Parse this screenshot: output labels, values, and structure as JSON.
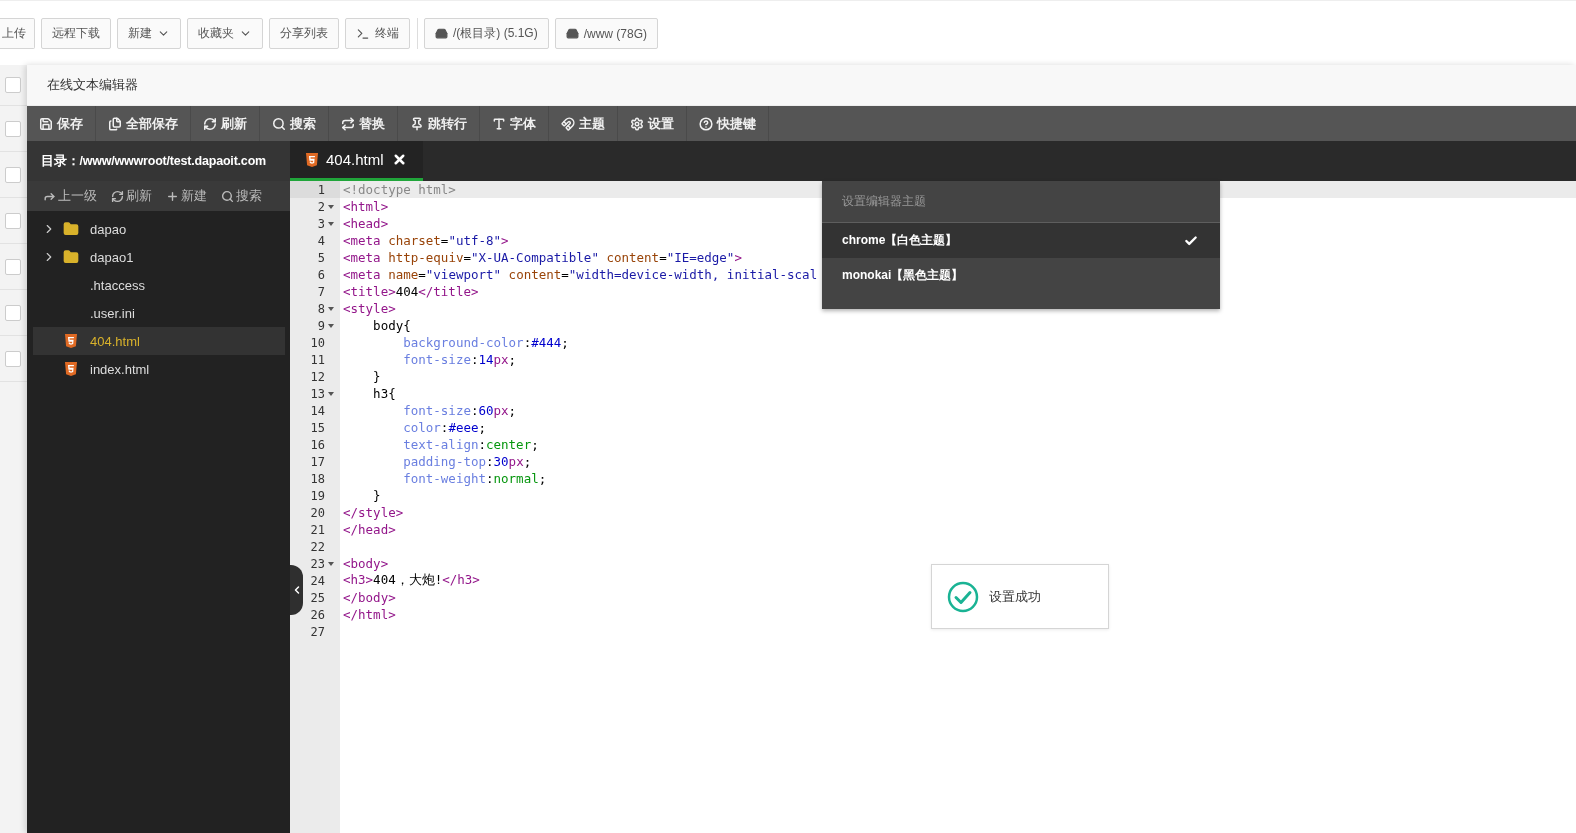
{
  "top_toolbar": [
    {
      "label": "上传",
      "kind": "plain"
    },
    {
      "label": "远程下载",
      "kind": "plain"
    },
    {
      "label": "新建",
      "kind": "dropdown"
    },
    {
      "label": "收藏夹",
      "kind": "dropdown"
    },
    {
      "label": "分享列表",
      "kind": "plain"
    },
    {
      "label": "终端",
      "kind": "terminal"
    },
    {
      "label": "/(根目录) (5.1G)",
      "kind": "disk"
    },
    {
      "label": "/www (78G)",
      "kind": "disk"
    }
  ],
  "background_rows": [
    {
      "checked": false
    },
    {
      "checked": false
    },
    {
      "checked": false
    },
    {
      "checked": false
    },
    {
      "checked": false
    },
    {
      "checked": false
    },
    {
      "checked": false
    }
  ],
  "window": {
    "title": "在线文本编辑器"
  },
  "editor_toolbar": [
    "保存",
    "全部保存",
    "刷新",
    "搜索",
    "替换",
    "跳转行",
    "字体",
    "主题",
    "设置",
    "快捷键"
  ],
  "sidebar": {
    "directory": "目录：/www/wwwroot/test.dapaoit.com",
    "actions": [
      "上一级",
      "刷新",
      "新建",
      "搜索"
    ],
    "items": [
      {
        "name": "dapao",
        "kind": "folder",
        "selected": false
      },
      {
        "name": "dapao1",
        "kind": "folder",
        "selected": false
      },
      {
        "name": ".htaccess",
        "kind": "file",
        "selected": false
      },
      {
        "name": ".user.ini",
        "kind": "file",
        "selected": false
      },
      {
        "name": "404.html",
        "kind": "html",
        "selected": true
      },
      {
        "name": "index.html",
        "kind": "html",
        "selected": false
      }
    ]
  },
  "tabs": [
    {
      "label": "404.html",
      "selected": true
    }
  ],
  "code_lines": [
    {
      "number": "1",
      "active": true,
      "foldable": false,
      "text": "<!doctype html>"
    },
    {
      "number": "2",
      "active": false,
      "foldable": true,
      "text": "<html>"
    },
    {
      "number": "3",
      "active": false,
      "foldable": true,
      "text": "<head>"
    },
    {
      "number": "4",
      "active": false,
      "foldable": false,
      "text": "<meta charset=\"utf-8\">"
    },
    {
      "number": "5",
      "active": false,
      "foldable": false,
      "text": "<meta http-equiv=\"X-UA-Compatible\" content=\"IE=edge\">"
    },
    {
      "number": "6",
      "active": false,
      "foldable": false,
      "text": "<meta name=\"viewport\" content=\"width=device-width, initial-scal"
    },
    {
      "number": "7",
      "active": false,
      "foldable": false,
      "text": "<title>404</title>"
    },
    {
      "number": "8",
      "active": false,
      "foldable": true,
      "text": "<style>"
    },
    {
      "number": "9",
      "active": false,
      "foldable": true,
      "text": "    body{"
    },
    {
      "number": "10",
      "active": false,
      "foldable": false,
      "text": "        background-color:#444;"
    },
    {
      "number": "11",
      "active": false,
      "foldable": false,
      "text": "        font-size:14px;"
    },
    {
      "number": "12",
      "active": false,
      "foldable": false,
      "text": "    }"
    },
    {
      "number": "13",
      "active": false,
      "foldable": true,
      "text": "    h3{"
    },
    {
      "number": "14",
      "active": false,
      "foldable": false,
      "text": "        font-size:60px;"
    },
    {
      "number": "15",
      "active": false,
      "foldable": false,
      "text": "        color:#eee;"
    },
    {
      "number": "16",
      "active": false,
      "foldable": false,
      "text": "        text-align:center;"
    },
    {
      "number": "17",
      "active": false,
      "foldable": false,
      "text": "        padding-top:30px;"
    },
    {
      "number": "18",
      "active": false,
      "foldable": false,
      "text": "        font-weight:normal;"
    },
    {
      "number": "19",
      "active": false,
      "foldable": false,
      "text": "    }"
    },
    {
      "number": "20",
      "active": false,
      "foldable": false,
      "text": "</style>"
    },
    {
      "number": "21",
      "active": false,
      "foldable": false,
      "text": "</head>"
    },
    {
      "number": "22",
      "active": false,
      "foldable": false
    },
    {
      "number": "23",
      "active": false,
      "foldable": true,
      "text": "<body>"
    },
    {
      "number": "24",
      "active": false,
      "foldable": false,
      "text": "<h3>404，大炮!</h3>"
    },
    {
      "number": "25",
      "active": false,
      "foldable": false,
      "text": "</body>"
    },
    {
      "number": "26",
      "active": false,
      "foldable": false,
      "text": "</html>"
    },
    {
      "number": "27",
      "active": false,
      "foldable": false
    }
  ],
  "theme_menu": {
    "title": "设置编辑器主题",
    "items": [
      {
        "label": "chrome【白色主题】",
        "selected": true
      },
      {
        "label": "monokai【黑色主题】",
        "selected": false
      }
    ]
  },
  "toast": {
    "message": "设置成功"
  }
}
